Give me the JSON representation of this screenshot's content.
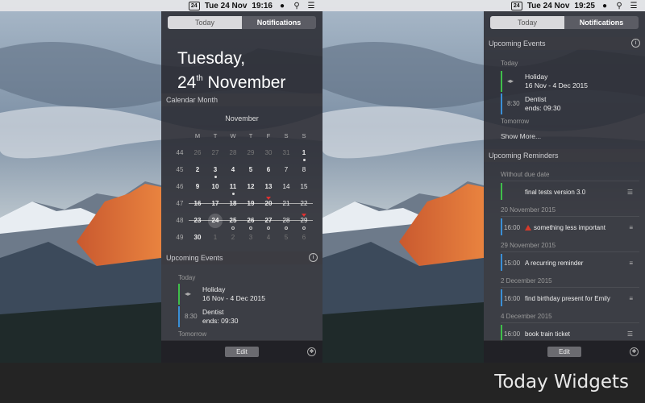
{
  "menubar": {
    "cal_icon_text": "24",
    "left_date": "Tue 24 Nov",
    "left_time": "19:16",
    "right_date": "Tue 24 Nov",
    "right_time": "19:25"
  },
  "tabs": {
    "today": "Today",
    "notifications": "Notifications"
  },
  "big_date": {
    "line1": "Tuesday,",
    "day": "24",
    "suffix": "th",
    "month": "November"
  },
  "calendar": {
    "section_title": "Calendar Month",
    "month": "November",
    "weekday_headers": [
      "M",
      "T",
      "W",
      "T",
      "F",
      "S",
      "S"
    ],
    "rows": [
      {
        "week": "44",
        "days": [
          "26",
          "27",
          "28",
          "29",
          "30",
          "31",
          "1"
        ]
      },
      {
        "week": "45",
        "days": [
          "2",
          "3",
          "4",
          "5",
          "6",
          "7",
          "8"
        ]
      },
      {
        "week": "46",
        "days": [
          "9",
          "10",
          "11",
          "12",
          "13",
          "14",
          "15"
        ]
      },
      {
        "week": "47",
        "days": [
          "16",
          "17",
          "18",
          "19",
          "20",
          "21",
          "22"
        ]
      },
      {
        "week": "48",
        "days": [
          "23",
          "24",
          "25",
          "26",
          "27",
          "28",
          "29"
        ]
      },
      {
        "week": "49",
        "days": [
          "30",
          "1",
          "2",
          "3",
          "4",
          "5",
          "6"
        ]
      }
    ]
  },
  "events": {
    "section_title": "Upcoming Events",
    "info_icon": "i",
    "today_label": "Today",
    "tomorrow_label": "Tomorrow",
    "holiday_title": "Holiday",
    "holiday_dates": "16 Nov - 4 Dec 2015",
    "dentist_time": "8:30",
    "dentist_title": "Dentist",
    "dentist_sub": "ends: 09:30",
    "show_more": "Show More..."
  },
  "reminders": {
    "section_title": "Upcoming Reminders",
    "groups": [
      {
        "header": "Without due date",
        "time": "",
        "title": "final tests version 3.0",
        "bar": "#3fbf4a",
        "warn": false
      },
      {
        "header": "20 November 2015",
        "time": "16:00",
        "title": "something less important",
        "bar": "#3a8fd6",
        "warn": true
      },
      {
        "header": "29 November 2015",
        "time": "15:00",
        "title": "A recurring reminder",
        "bar": "#3a8fd6",
        "warn": false
      },
      {
        "header": "2 December 2015",
        "time": "16:00",
        "title": "find birthday present for Emily",
        "bar": "#3a8fd6",
        "warn": false
      },
      {
        "header": "4 December 2015",
        "time": "16:00",
        "title": "book train ticket",
        "bar": "#3fbf4a",
        "warn": false
      }
    ]
  },
  "bottom": {
    "edit": "Edit"
  },
  "caption": "Today Widgets",
  "colors": {
    "holiday_bar": "#3fbf4a",
    "event_bar": "#3a8fd6",
    "today_marker": "#e03030"
  }
}
